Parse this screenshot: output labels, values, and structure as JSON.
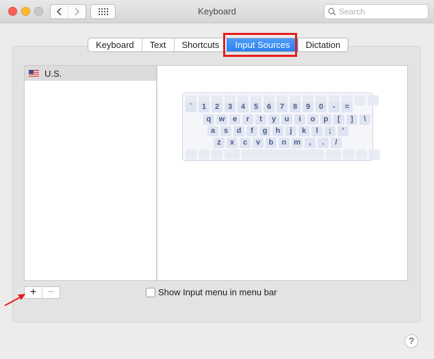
{
  "window": {
    "title": "Keyboard"
  },
  "search": {
    "placeholder": "Search"
  },
  "tabs": [
    {
      "label": "Keyboard"
    },
    {
      "label": "Text"
    },
    {
      "label": "Shortcuts"
    },
    {
      "label": "Input Sources",
      "active": true
    },
    {
      "label": "Dictation"
    }
  ],
  "sources": {
    "items": [
      {
        "label": "U.S.",
        "icon": "us-flag-icon"
      }
    ]
  },
  "keyboard_preview": {
    "rows": [
      [
        "`",
        "1",
        "2",
        "3",
        "4",
        "5",
        "6",
        "7",
        "8",
        "9",
        "0",
        "-",
        "="
      ],
      [
        "q",
        "w",
        "e",
        "r",
        "t",
        "y",
        "u",
        "i",
        "o",
        "p",
        "[",
        "]",
        "\\"
      ],
      [
        "a",
        "s",
        "d",
        "f",
        "g",
        "h",
        "j",
        "k",
        "l",
        ";",
        "'"
      ],
      [
        "z",
        "x",
        "c",
        "v",
        "b",
        "n",
        "m",
        ",",
        ".",
        "/"
      ]
    ]
  },
  "controls": {
    "add_label": "+",
    "remove_label": "−",
    "show_input_menu_label": "Show Input menu in menu bar",
    "show_input_menu_checked": false,
    "help_label": "?"
  },
  "colors": {
    "accent": "#2c7ff0",
    "highlight": "#e41c1c"
  }
}
